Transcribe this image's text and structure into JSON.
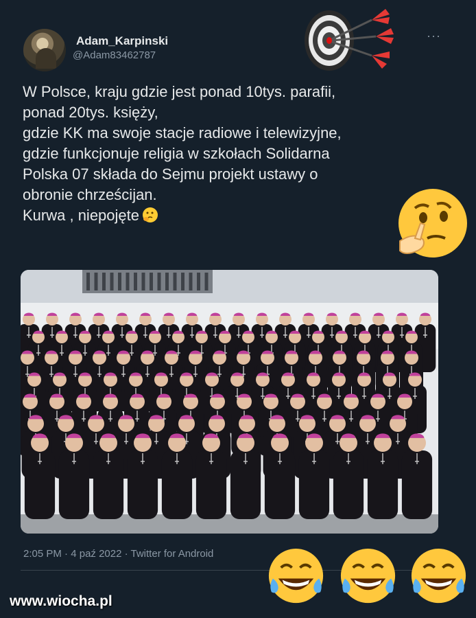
{
  "tweet": {
    "author_name": "Adam_Karpinski",
    "author_handle": "@Adam83462787",
    "more_label": "···",
    "text_lines": [
      "W Polsce, kraju gdzie jest ponad 10tys. parafii,",
      "ponad 20tys. księży,",
      "gdzie KK ma swoje stacje radiowe i telewizyjne,",
      "gdzie funkcjonuje religia w szkołach Solidarna",
      "Polska 07 składa do Sejmu projekt ustawy o",
      "obronie chrześcijan.",
      "Kurwa , niepojęte"
    ],
    "time": "2:05 PM",
    "date": "4 paź 2022",
    "client": "Twitter for Android"
  },
  "watermark": "www.wiocha.pl",
  "icons": {
    "avatar": "avatar",
    "more": "more-dots-icon",
    "inline_emoji": "thinking-face-icon",
    "sticker_top": "dartboard-icon",
    "sticker_mid": "thinking-face-icon",
    "sticker_bottom": "laughing-crying-face-icon"
  },
  "colors": {
    "background": "#15202b",
    "text": "#e7e9ea",
    "secondary": "#8b98a5",
    "cassock": "#17151a",
    "zucchetto": "#c0419b"
  }
}
